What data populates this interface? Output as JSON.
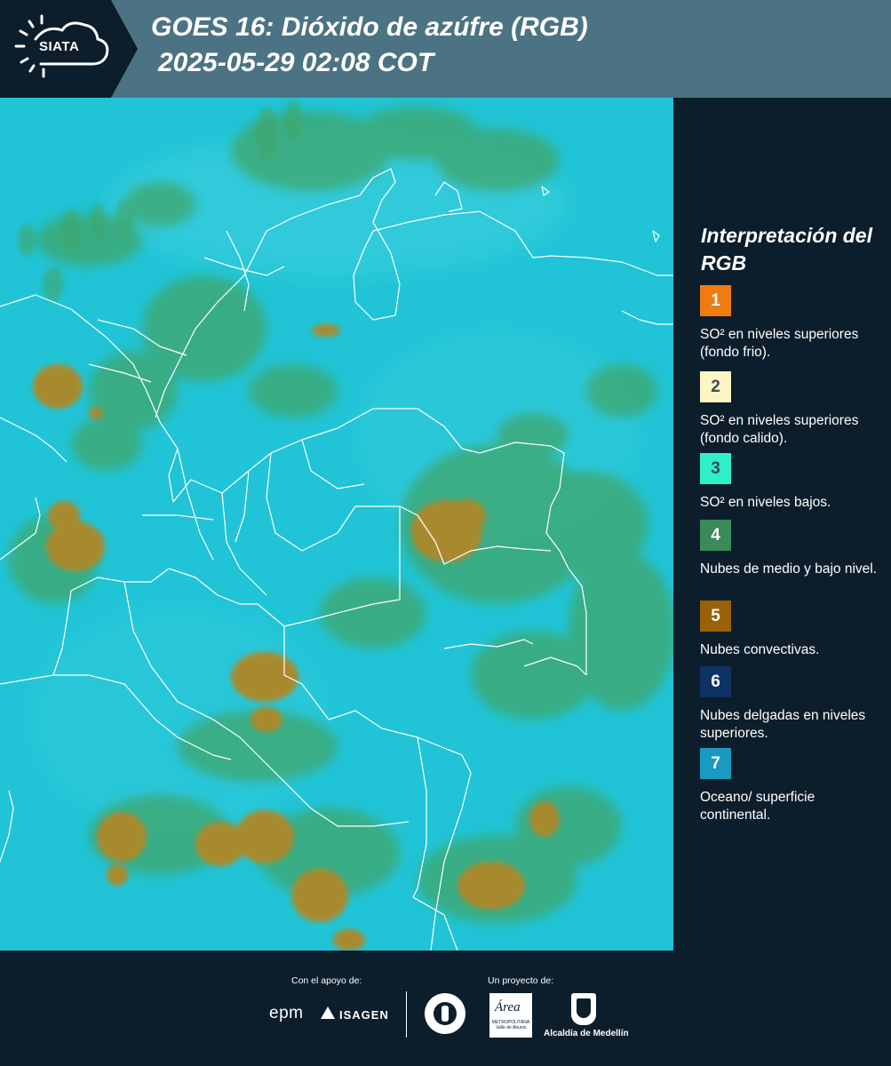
{
  "header": {
    "logo_text": "SIATA",
    "title_line1": "GOES 16: Dióxido de azúfre (RGB)",
    "title_line2": "2025-05-29 02:08 COT"
  },
  "legend": {
    "title": "Interpretación del RGB",
    "items": [
      {
        "number": "1",
        "color": "#f07c10",
        "text": "SO² en niveles superiores (fondo frio)."
      },
      {
        "number": "2",
        "color": "#fdf6c4",
        "text": "SO² en niveles superiores (fondo calido)."
      },
      {
        "number": "3",
        "color": "#2ef0c8",
        "text": "SO² en niveles bajos."
      },
      {
        "number": "4",
        "color": "#3a8a5a",
        "text": "Nubes de medio y bajo nivel."
      },
      {
        "number": "5",
        "color": "#9a6208",
        "text": "Nubes convectivas."
      },
      {
        "number": "6",
        "color": "#0e3264",
        "text": "Nubes delgadas en niveles superiores."
      },
      {
        "number": "7",
        "color": "#1a9ac0",
        "text": "Oceano/ superficie continental."
      }
    ]
  },
  "footer": {
    "support_label": "Con el apoyo de:",
    "project_label": "Un proyecto de:",
    "sponsor_epm": "epm",
    "sponsor_isagen": "ISAGEN",
    "partner_area": "Área",
    "partner_area_sub": "METROPOLITANA Valle de Aburrá",
    "partner_alcaldia": "Alcaldía de Medellín"
  },
  "colors": {
    "header_bg": "#4c7383",
    "panel_bg": "#0c1e2b",
    "map_background": "#20c4d6",
    "low_cloud": "#3fa66a",
    "convective_cloud": "#a88a2e",
    "borders": "#ffffff"
  }
}
